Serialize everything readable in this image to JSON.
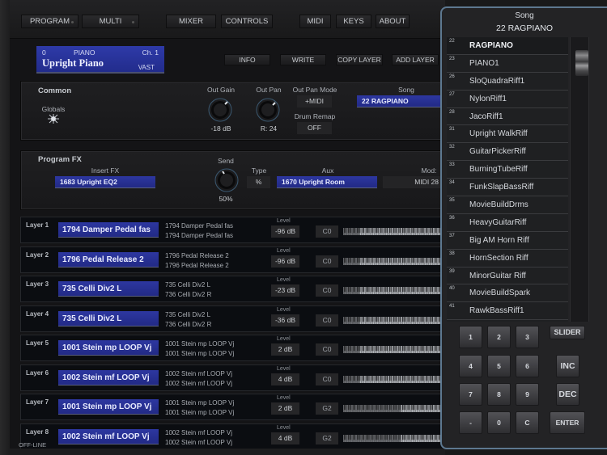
{
  "nav": {
    "program": "PROGRAM",
    "multi": "MULTI",
    "mixer": "MIXER",
    "controls": "CONTROLS",
    "midi": "MIDI",
    "keys": "KEYS",
    "about": "ABOUT"
  },
  "display": {
    "number": "0",
    "category": "PIANO",
    "channel": "Ch. 1",
    "name": "Upright Piano",
    "engine": "VAST"
  },
  "actions": {
    "info": "INFO",
    "write": "WRITE",
    "copy_layer": "COPY LAYER",
    "add_layer": "ADD LAYER"
  },
  "common": {
    "title": "Common",
    "globals_label": "Globals",
    "out_gain_label": "Out Gain",
    "out_gain_value": "-18 dB",
    "out_pan_label": "Out Pan",
    "out_pan_value": "R: 24",
    "out_pan_mode_label": "Out Pan Mode",
    "out_pan_mode_value": "+MIDI",
    "drum_remap_label": "Drum Remap",
    "drum_remap_value": "OFF",
    "song_label": "Song",
    "song_value": "22 RAGPIANO"
  },
  "program_fx": {
    "title": "Program FX",
    "insert_label": "Insert FX",
    "insert_value": "1683 Upright EQ2",
    "send_label": "Send",
    "send_value": "50%",
    "type_label": "Type",
    "type_value": "%",
    "aux_label": "Aux",
    "aux_value": "1670 Upright Room",
    "mod_label": "Mod:",
    "mod_value": "MIDI 28"
  },
  "layers": [
    {
      "label": "Layer 1",
      "program": "1794 Damper Pedal fas",
      "keymap1": "1794 Damper Pedal fas",
      "keymap2": "1794 Damper Pedal fas",
      "level_label": "Level",
      "level": "-96 dB",
      "key": "C0"
    },
    {
      "label": "Layer 2",
      "program": "1796 Pedal Release 2",
      "keymap1": "1796 Pedal Release 2",
      "keymap2": "1796 Pedal Release 2",
      "level_label": "Level",
      "level": "-96 dB",
      "key": "C0"
    },
    {
      "label": "Layer 3",
      "program": "735 Celli Div2 L",
      "keymap1": "735 Celli Div2 L",
      "keymap2": "736 Celli Div2 R",
      "level_label": "Level",
      "level": "-23 dB",
      "key": "C0"
    },
    {
      "label": "Layer 4",
      "program": "735 Celli Div2 L",
      "keymap1": "735 Celli Div2 L",
      "keymap2": "736 Celli Div2 R",
      "level_label": "Level",
      "level": "-36 dB",
      "key": "C0"
    },
    {
      "label": "Layer 5",
      "program": "1001 Stein mp LOOP Vj",
      "keymap1": "1001 Stein mp LOOP Vj",
      "keymap2": "1001 Stein mp LOOP Vj",
      "level_label": "Level",
      "level": "2 dB",
      "key": "C0"
    },
    {
      "label": "Layer 6",
      "program": "1002 Stein mf LOOP Vj",
      "keymap1": "1002 Stein mf LOOP Vj",
      "keymap2": "1002 Stein mf LOOP Vj",
      "level_label": "Level",
      "level": "4 dB",
      "key": "C0"
    },
    {
      "label": "Layer 7",
      "program": "1001 Stein mp LOOP Vj",
      "keymap1": "1001 Stein mp LOOP Vj",
      "keymap2": "1001 Stein mp LOOP Vj",
      "level_label": "Level",
      "level": "2 dB",
      "key": "G2"
    },
    {
      "label": "Layer 8",
      "program": "1002 Stein mf LOOP Vj",
      "keymap1": "1002 Stein mf LOOP Vj",
      "keymap2": "1002 Stein mf LOOP Vj",
      "level_label": "Level",
      "level": "4 dB",
      "key": "G2"
    }
  ],
  "status": "OFF-LINE",
  "song_popup": {
    "title": "Song",
    "current": "22 RAGPIANO",
    "items": [
      {
        "num": "22",
        "name": "RAGPIANO",
        "selected": true
      },
      {
        "num": "23",
        "name": "PIANO1"
      },
      {
        "num": "26",
        "name": "SloQuadraRiff1"
      },
      {
        "num": "27",
        "name": "NylonRiff1"
      },
      {
        "num": "28",
        "name": "JacoRiff1"
      },
      {
        "num": "31",
        "name": "Upright WalkRiff"
      },
      {
        "num": "32",
        "name": "GuitarPickerRiff"
      },
      {
        "num": "33",
        "name": "BurningTubeRiff"
      },
      {
        "num": "34",
        "name": "FunkSlapBassRiff"
      },
      {
        "num": "35",
        "name": "MovieBuildDrms"
      },
      {
        "num": "36",
        "name": "HeavyGuitarRiff"
      },
      {
        "num": "37",
        "name": "Big AM Horn Riff"
      },
      {
        "num": "38",
        "name": "HornSection Riff"
      },
      {
        "num": "39",
        "name": "MinorGuitar Riff"
      },
      {
        "num": "40",
        "name": "MovieBuildSpark"
      },
      {
        "num": "41",
        "name": "RawkBassRiff1"
      }
    ],
    "keypad": [
      "1",
      "2",
      "3",
      "4",
      "5",
      "6",
      "7",
      "8",
      "9",
      "-",
      "0",
      "C"
    ],
    "slider": "SLIDER",
    "inc": "INC",
    "dec": "DEC",
    "enter": "ENTER"
  }
}
